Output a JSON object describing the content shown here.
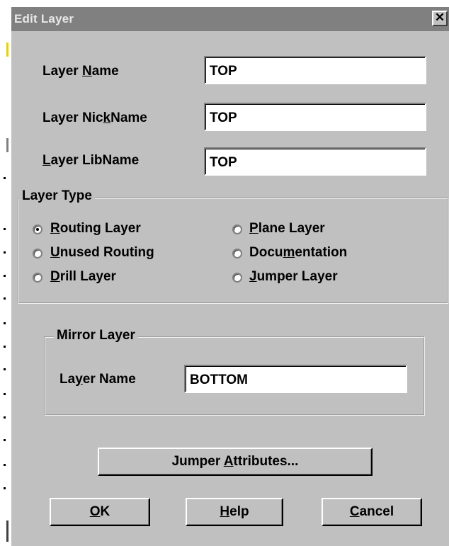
{
  "window": {
    "title": "Edit Layer",
    "close_glyph": "✕"
  },
  "fields": {
    "layer_name": {
      "label": "Layer Name",
      "value": "TOP"
    },
    "layer_nickname": {
      "label": "Layer NickName",
      "value": "TOP"
    },
    "layer_libname": {
      "label": "Layer LibName",
      "value": "TOP"
    }
  },
  "layer_type": {
    "title": "Layer Type",
    "options": [
      {
        "label": "Routing Layer",
        "selected": true
      },
      {
        "label": "Plane Layer",
        "selected": false
      },
      {
        "label": "Unused Routing",
        "selected": false
      },
      {
        "label": "Documentation",
        "selected": false
      },
      {
        "label": "Drill Layer",
        "selected": false
      },
      {
        "label": "Jumper Layer",
        "selected": false
      }
    ]
  },
  "mirror_layer": {
    "title": "Mirror Layer",
    "label": "Layer Name",
    "value": "BOTTOM"
  },
  "buttons": {
    "jumper_attributes": "Jumper Attributes...",
    "ok": "OK",
    "help": "Help",
    "cancel": "Cancel"
  },
  "colors": {
    "face": "#c0c0c0",
    "title_bar": "#808080",
    "field": "#ffffff"
  }
}
